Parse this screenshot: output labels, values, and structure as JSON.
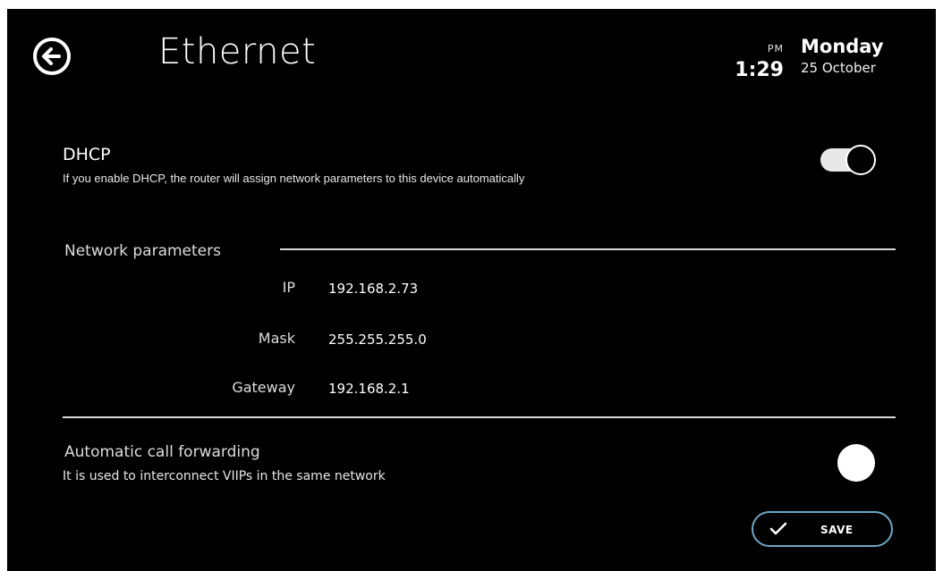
{
  "header": {
    "title": "Ethernet",
    "back_icon": "arrow-left-circle-icon"
  },
  "clock": {
    "ampm": "PM",
    "time": "1:29",
    "day": "Monday",
    "date": "25 October"
  },
  "dhcp": {
    "title": "DHCP",
    "description": "If you enable DHCP, the router will assign network parameters to this device automatically",
    "enabled": true
  },
  "network": {
    "section_label": "Network parameters",
    "params": [
      {
        "label": "IP",
        "value": "192.168.2.73"
      },
      {
        "label": "Mask",
        "value": "255.255.255.0"
      },
      {
        "label": "Gateway",
        "value": "192.168.2.1"
      }
    ]
  },
  "call_forwarding": {
    "title": "Automatic call forwarding",
    "description": "It is used to interconnect VIIPs in the same network",
    "enabled": false
  },
  "actions": {
    "save_label": "SAVE",
    "save_icon": "checkmark-icon"
  },
  "colors": {
    "background": "#000000",
    "text": "#ffffff",
    "save_border": "#6fa8c8"
  }
}
